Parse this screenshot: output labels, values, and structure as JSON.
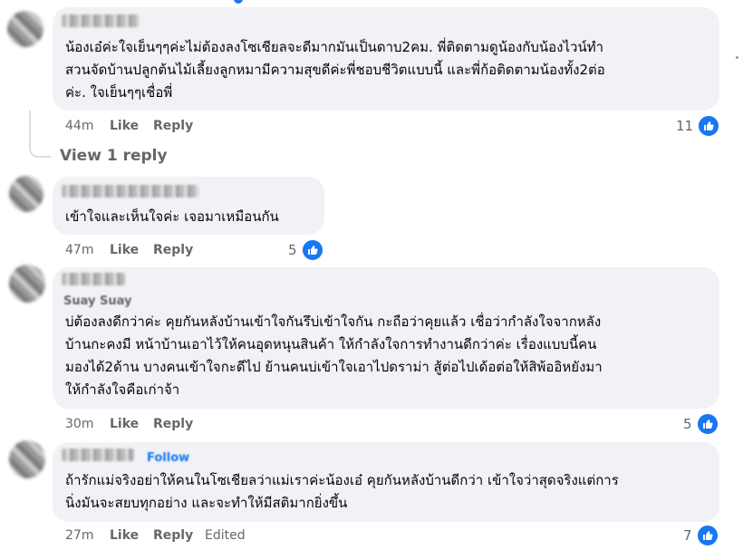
{
  "comments": [
    {
      "text_lines": [
        "น้องเอ๋ค่ะใจเย็นๆๆค่ะไม่ต้องลงโซเชียลจะดีมากมันเป็นดาบ2คม. พี่ติดตามดูน้องกับน้องไวน์ทำ",
        "สวนจัดบ้านปลูกต้นไม้เลี้ยงลูกหมามีความสุขดีค่ะพี่ชอบชีวิตแบบนี้ และพี่ก้อติดตามน้องทั้ง2ต่อ",
        "ค่ะ. ใจเย็นๆๆเชื่อพี่"
      ],
      "time": "44m",
      "like": "Like",
      "reply": "Reply",
      "reactions": "11"
    },
    {
      "text_lines": [
        "เข้าใจและเห็นใจค่ะ เจอมาเหมือนกัน"
      ],
      "time": "47m",
      "like": "Like",
      "reply": "Reply",
      "reactions": "5"
    },
    {
      "name_ghost": "Suay Suay",
      "text_lines": [
        "บ่ต้องลงดีกว่าค่ะ คุยกันหลังบ้านเข้าใจกันรึบ่เข้าใจกัน กะถือว่าคุยแล้ว เชื่อว่ากำลังใจจากหลัง",
        "บ้านกะคงมี หน้าบ้านเอาไว้ให้คนอุดหนุนสินค้า ให้กำลังใจการทำงานดีกว่าค่ะ เรื่องแบบนี้คน",
        "มองได้2ด้าน บางคนเข้าใจกะดีไป ย้านคนบ่เข้าใจเอาไปดราม่า สู้ต่อไปเด้อต่อให้สิพ้ออิหยังมา",
        "ให้กำลังใจคือเก่าจ้า"
      ],
      "time": "30m",
      "like": "Like",
      "reply": "Reply",
      "reactions": "5"
    },
    {
      "name_ghost": "Follow",
      "text_lines": [
        "ถ้ารักแม่จริงอย่าให้คนในโซเชียลว่าแม่เราค่ะน้องเอ๋ คุยกันหลังบ้านดีกว่า เข้าใจว่าสุดจริงแต่การ",
        "นิ่งมันจะสยบทุกอย่าง และจะทำให้มีสติมากยิ่งขึ้น"
      ],
      "time": "27m",
      "like": "Like",
      "reply": "Reply",
      "edited": "Edited",
      "reactions": "7"
    }
  ],
  "view_reply": "View 1 reply",
  "colors": {
    "like_blue": "#1877f2",
    "bubble": "#f0f2f5",
    "meta": "#65676b"
  }
}
